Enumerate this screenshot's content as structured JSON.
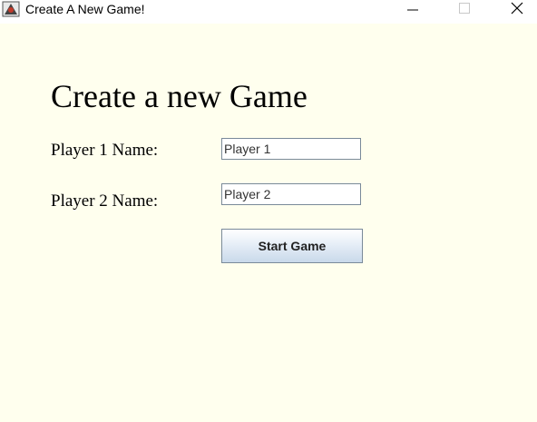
{
  "window": {
    "title": "Create A New Game!",
    "icon": "app-card-icon",
    "background_color": "#ffffee"
  },
  "form": {
    "heading": "Create a new Game",
    "player1": {
      "label": "Player 1 Name:",
      "value": "Player 1"
    },
    "player2": {
      "label": "Player 2 Name:",
      "value": "Player 2"
    },
    "start_button_label": "Start Game"
  },
  "controls": {
    "minimize_icon": "minimize-icon",
    "maximize_icon": "maximize-icon",
    "close_icon": "close-icon"
  }
}
